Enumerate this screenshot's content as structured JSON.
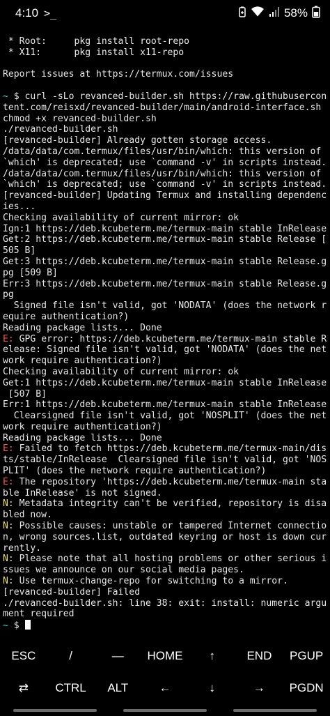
{
  "status_bar": {
    "time": "4:10",
    "terminal_indicator": ">_",
    "battery_percent": "58%",
    "icons": [
      "battery-saver-icon",
      "wifi-icon",
      "signal-icon",
      "battery-icon"
    ]
  },
  "terminal": {
    "lines": [
      {
        "text": " * Root:     pkg install root-repo"
      },
      {
        "text": " * X11:      pkg install x11-repo"
      },
      {
        "text": ""
      },
      {
        "text": "Report issues at https://termux.com/issues"
      },
      {
        "text": ""
      },
      {
        "prefix": "~",
        "prefix_color": "cyan",
        "text": " $ curl -sLo revanced-builder.sh https://raw.githubusercon"
      },
      {
        "text": "tent.com/reisxd/revanced-builder/main/android-interface.sh"
      },
      {
        "text": "chmod +x revanced-builder.sh"
      },
      {
        "text": "./revanced-builder.sh"
      },
      {
        "text": "[revanced-builder] Already gotten storage access."
      },
      {
        "text": "/data/data/com.termux/files/usr/bin/which: this version of"
      },
      {
        "text": "`which' is deprecated; use `command -v' in scripts instead."
      },
      {
        "text": "/data/data/com.termux/files/usr/bin/which: this version of"
      },
      {
        "text": "`which' is deprecated; use `command -v' in scripts instead."
      },
      {
        "text": "[revanced-builder] Updating Termux and installing dependenc"
      },
      {
        "text": "ies..."
      },
      {
        "text": "Checking availability of current mirror: ok"
      },
      {
        "text": "Ign:1 https://deb.kcubeterm.me/termux-main stable InRelease"
      },
      {
        "text": "Get:2 https://deb.kcubeterm.me/termux-main stable Release ["
      },
      {
        "text": "505 B]"
      },
      {
        "text": "Get:3 https://deb.kcubeterm.me/termux-main stable Release.g"
      },
      {
        "text": "pg [509 B]"
      },
      {
        "text": "Err:3 https://deb.kcubeterm.me/termux-main stable Release.g"
      },
      {
        "text": "pg"
      },
      {
        "text": "  Signed file isn't valid, got 'NODATA' (does the network r"
      },
      {
        "text": "equire authentication?)"
      },
      {
        "text": "Reading package lists... Done"
      },
      {
        "prefix": "E:",
        "prefix_color": "red",
        "text": " GPG error: https://deb.kcubeterm.me/termux-main stable R"
      },
      {
        "text": "elease: Signed file isn't valid, got 'NODATA' (does the net"
      },
      {
        "text": "work require authentication?)"
      },
      {
        "text": "Checking availability of current mirror: ok"
      },
      {
        "text": "Get:1 https://deb.kcubeterm.me/termux-main stable InRelease"
      },
      {
        "text": " [507 B]"
      },
      {
        "text": "Err:1 https://deb.kcubeterm.me/termux-main stable InRelease"
      },
      {
        "text": "  Clearsigned file isn't valid, got 'NOSPLIT' (does the net"
      },
      {
        "text": "work require authentication?)"
      },
      {
        "text": "Reading package lists... Done"
      },
      {
        "prefix": "E:",
        "prefix_color": "red",
        "text": " Failed to fetch https://deb.kcubeterm.me/termux-main/dis"
      },
      {
        "text": "ts/stable/InRelease  Clearsigned file isn't valid, got 'NOS"
      },
      {
        "text": "PLIT' (does the network require authentication?)"
      },
      {
        "prefix": "E:",
        "prefix_color": "red",
        "text": " The repository 'https://deb.kcubeterm.me/termux-main sta"
      },
      {
        "text": "ble InRelease' is not signed."
      },
      {
        "prefix": "N:",
        "prefix_color": "yellow",
        "text": " Metadata integrity can't be verified, repository is disa"
      },
      {
        "text": "bled now."
      },
      {
        "prefix": "N:",
        "prefix_color": "yellow",
        "text": " Possible causes: unstable or tampered Internet connectio"
      },
      {
        "text": "n, wrong sources.list, outdated keyring or host is down cur"
      },
      {
        "text": "rently."
      },
      {
        "prefix": "N:",
        "prefix_color": "yellow",
        "text": " Please note that all hosting problems or other serious i"
      },
      {
        "text": "ssues we announce on our social media pages."
      },
      {
        "prefix": "N:",
        "prefix_color": "yellow",
        "text": " Use termux-change-repo for switching to a mirror."
      },
      {
        "text": "[revanced-builder] Failed"
      },
      {
        "text": "./revanced-builder.sh: line 38: exit: install: numeric argu"
      },
      {
        "text": "ment required"
      },
      {
        "prefix": "~",
        "prefix_color": "cyan",
        "text": " $ ",
        "cursor": true
      }
    ]
  },
  "extra_keys": {
    "row1": [
      {
        "label": "ESC",
        "name": "esc-key"
      },
      {
        "label": "/",
        "name": "slash-key"
      },
      {
        "label": "—",
        "name": "dash-key"
      },
      {
        "label": "HOME",
        "name": "home-key"
      },
      {
        "label": "↑",
        "name": "arrow-up-key"
      },
      {
        "label": "END",
        "name": "end-key"
      },
      {
        "label": "PGUP",
        "name": "pgup-key"
      }
    ],
    "row2": [
      {
        "label": "⇄",
        "name": "tab-key"
      },
      {
        "label": "CTRL",
        "name": "ctrl-key"
      },
      {
        "label": "ALT",
        "name": "alt-key"
      },
      {
        "label": "←",
        "name": "arrow-left-key"
      },
      {
        "label": "↓",
        "name": "arrow-down-key"
      },
      {
        "label": "→",
        "name": "arrow-right-key"
      },
      {
        "label": "PGDN",
        "name": "pgdn-key"
      }
    ]
  },
  "colors": {
    "background": "#000000",
    "text": "#e8e8e8",
    "error_prefix": "#ff4d4d",
    "notice_prefix": "#e8e070",
    "prompt": "#3fd6c6"
  }
}
